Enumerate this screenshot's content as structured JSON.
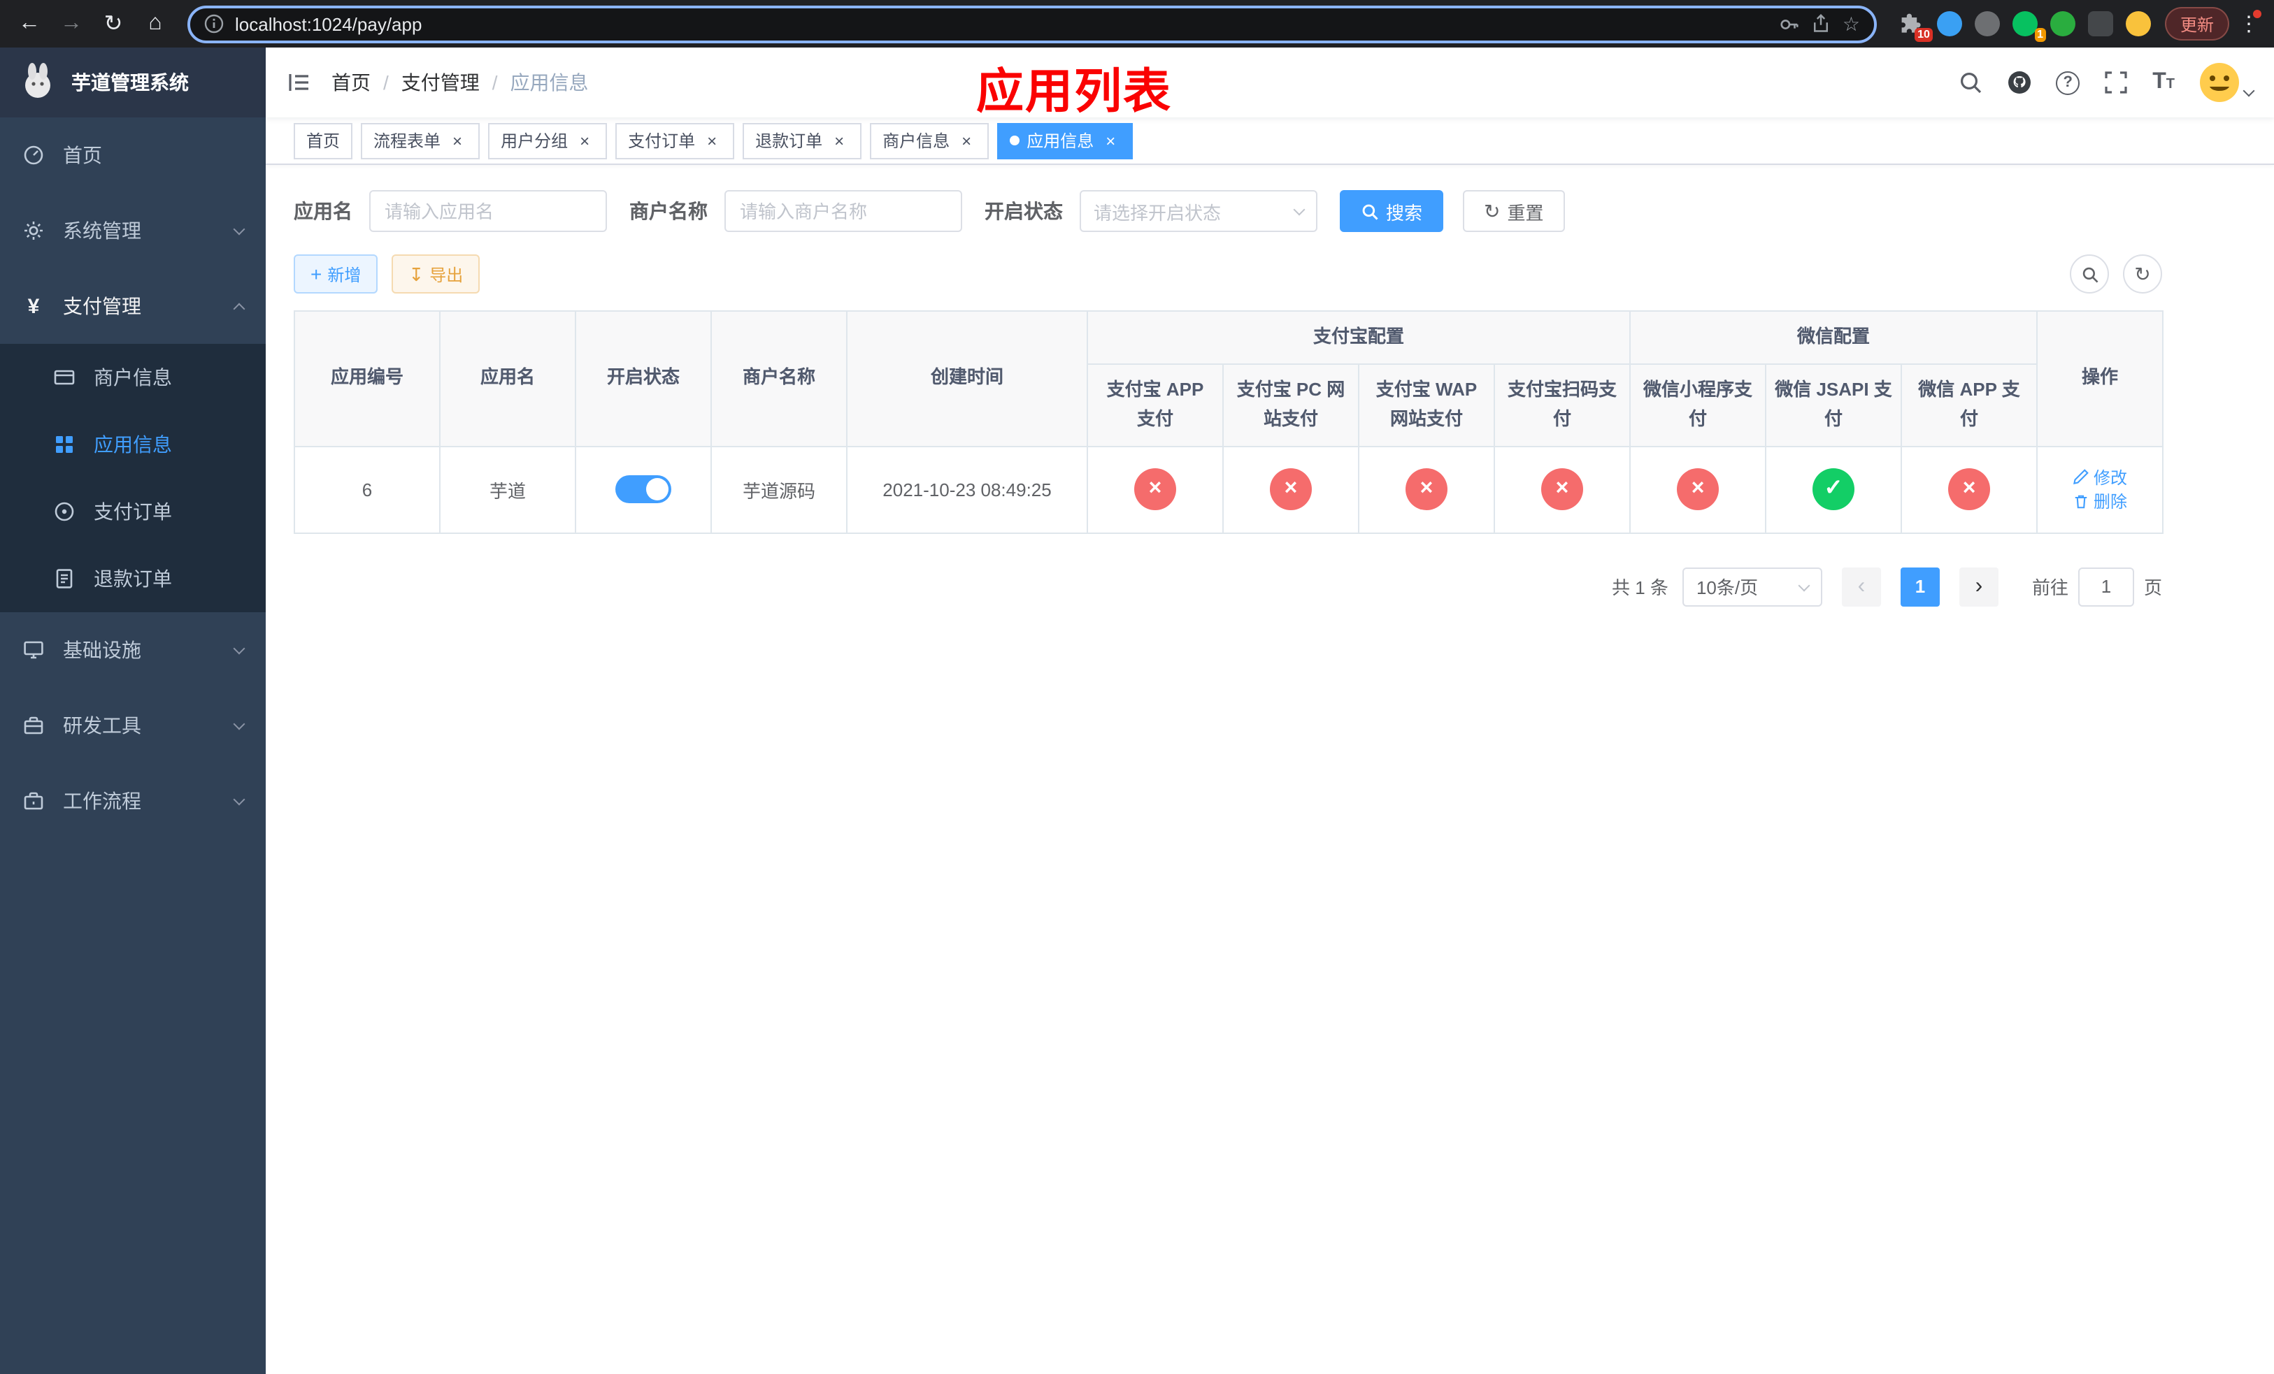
{
  "annotation": {
    "title": "应用列表"
  },
  "browser": {
    "url": "localhost:1024/pay/app",
    "update_label": "更新",
    "puzzle_badge": "10",
    "message_badge": "1"
  },
  "sidebar": {
    "logo_title": "芋道管理系统",
    "items": [
      {
        "label": "首页"
      },
      {
        "label": "系统管理"
      },
      {
        "label": "支付管理"
      },
      {
        "label": "商户信息"
      },
      {
        "label": "应用信息"
      },
      {
        "label": "支付订单"
      },
      {
        "label": "退款订单"
      },
      {
        "label": "基础设施"
      },
      {
        "label": "研发工具"
      },
      {
        "label": "工作流程"
      }
    ]
  },
  "header": {
    "breadcrumb": [
      "首页",
      "支付管理",
      "应用信息"
    ]
  },
  "tags": [
    {
      "label": "首页"
    },
    {
      "label": "流程表单"
    },
    {
      "label": "用户分组"
    },
    {
      "label": "支付订单"
    },
    {
      "label": "退款订单"
    },
    {
      "label": "商户信息"
    },
    {
      "label": "应用信息"
    }
  ],
  "filters": {
    "app_name_label": "应用名",
    "app_name_placeholder": "请输入应用名",
    "merchant_label": "商户名称",
    "merchant_placeholder": "请输入商户名称",
    "status_label": "开启状态",
    "status_placeholder": "请选择开启状态",
    "search_label": "搜索",
    "reset_label": "重置"
  },
  "toolbar": {
    "add_label": "新增",
    "export_label": "导出"
  },
  "table": {
    "headers": {
      "id": "应用编号",
      "name": "应用名",
      "status": "开启状态",
      "merchant": "商户名称",
      "created": "创建时间",
      "alipay_group": "支付宝配置",
      "wechat_group": "微信配置",
      "alipay_app": "支付宝 APP 支付",
      "alipay_pc": "支付宝 PC 网站支付",
      "alipay_wap": "支付宝 WAP 网站支付",
      "alipay_qr": "支付宝扫码支付",
      "wechat_mini": "微信小程序支付",
      "wechat_jsapi": "微信 JSAPI 支付",
      "wechat_app": "微信 APP 支付",
      "actions": "操作"
    },
    "rows": [
      {
        "id": "6",
        "name": "芋道",
        "enabled": true,
        "merchant": "芋道源码",
        "created": "2021-10-23 08:49:25",
        "statuses": [
          "no",
          "no",
          "no",
          "no",
          "no",
          "yes",
          "no"
        ],
        "edit_label": "修改",
        "delete_label": "删除"
      }
    ]
  },
  "pagination": {
    "total": "共 1 条",
    "page_size": "10条/页",
    "current_page": "1",
    "goto_label": "前往",
    "goto_value": "1",
    "page_unit": "页"
  },
  "colors": {
    "accent": "#409eff",
    "danger": "#f56c6c",
    "success": "#13ce66",
    "warning": "#e6a23c",
    "sidebar_bg": "#304156",
    "sidebar_sub_bg": "#1f2d3d"
  }
}
